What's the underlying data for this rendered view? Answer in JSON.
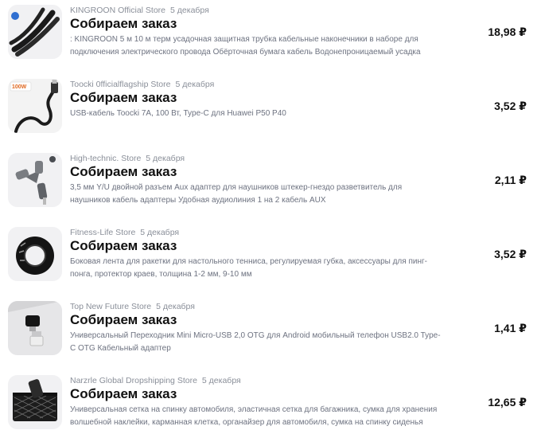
{
  "currency_symbol": "₽",
  "orders": [
    {
      "store": "KINGROON Official Store",
      "date": "5 декабря",
      "status": "Собираем заказ",
      "description": ": KINGROON 5 м 10 м терм усадочная защитная трубка кабельные наконечники в наборе для подключения электрического провода Обёрточная бумага кабель Водонепроницаемый усадка",
      "price": "18,98 ₽",
      "thumb_icon": "heat-shrink-tube-icon"
    },
    {
      "store": "Toocki 0fficialflagship Store",
      "date": "5 декабря",
      "status": "Собираем заказ",
      "description": "USB-кабель Toocki 7A, 100 Вт, Type-C для Huawei P50 P40",
      "price": "3,52 ₽",
      "thumb_icon": "usb-cable-icon",
      "thumb_text": "100W"
    },
    {
      "store": "High-technic. Store",
      "date": "5 декабря",
      "status": "Собираем заказ",
      "description": "3,5 мм Y/U двойной разъем Aux адаптер для наушников штекер-гнездо разветвитель для наушников кабель адаптеры Удобная аудиолиния 1 на 2 кабель AUX",
      "price": "2,11 ₽",
      "thumb_icon": "audio-splitter-icon"
    },
    {
      "store": "Fitness-Life Store",
      "date": "5 декабря",
      "status": "Собираем заказ",
      "description": "Боковая лента для ракетки для настольного тенниса, регулируемая губка, аксессуары для пинг-понга, протектор краев, толщина 1-2 мм, 9-10 мм",
      "price": "3,52 ₽",
      "thumb_icon": "edge-tape-roll-icon"
    },
    {
      "store": "Top New Future Store",
      "date": "5 декабря",
      "status": "Собираем заказ",
      "description": "Универсальный Переходник Mini Micro-USB 2,0 OTG для Android мобильный телефон USB2.0 Type-C OTG Кабельный адаптер",
      "price": "1,41 ₽",
      "thumb_icon": "otg-adapter-icon"
    },
    {
      "store": "Narzrle Global Dropshipping Store",
      "date": "5 декабря",
      "status": "Собираем заказ",
      "description": "Универсальная сетка на спинку автомобиля, эластичная сетка для багажника, сумка для хранения волшебной наклейки, карманная клетка, органайзер для автомобиля, сумка на спинку сиденья",
      "price": "12,65 ₽",
      "thumb_icon": "car-net-pocket-icon"
    }
  ]
}
